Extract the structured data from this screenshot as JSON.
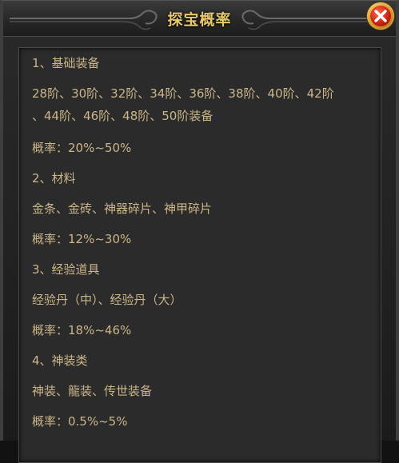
{
  "window": {
    "title": "探宝概率",
    "close_icon": "close-x-icon"
  },
  "sections": [
    {
      "heading": "1、基础装备",
      "items_line1": "28阶、30阶、32阶、34阶、36阶、38阶、40阶、42阶",
      "items_line2": "、44阶、46阶、48阶、50阶装备",
      "probability": "概率：20%~50%"
    },
    {
      "heading": "2、材料",
      "items_line1": "金条、金砖、神器碎片、神甲碎片",
      "probability": "概率：12%~30%"
    },
    {
      "heading": "3、经验道具",
      "items_line1": "经验丹（中）、经验丹（大）",
      "probability": "概率：18%~46%"
    },
    {
      "heading": "4、神装类",
      "items_line1": "神装、龍装、传世装备",
      "probability": "概率：0.5%~5%"
    }
  ],
  "colors": {
    "title": "#e8c86f",
    "text": "#cbb58a",
    "panel_bg": "#2b2b2b",
    "window_bg": "#1b1b1b"
  }
}
